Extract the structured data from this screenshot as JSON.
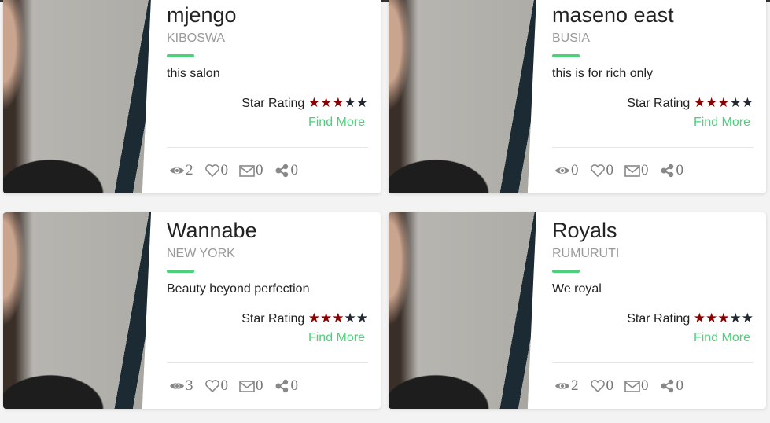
{
  "rating_label": "Star Rating",
  "find_more": "Find More",
  "colors": {
    "accent": "#4cd17a",
    "star_on": "#8b0000",
    "star_off": "#222831"
  },
  "cards": [
    {
      "title": "mjengo",
      "location": "KIBOSWA",
      "description": "this salon",
      "rating": 3,
      "views": "2",
      "likes": "0",
      "messages": "0",
      "shares": "0"
    },
    {
      "title": "maseno east",
      "location": "BUSIA",
      "description": "this is for rich only",
      "rating": 3,
      "views": "0",
      "likes": "0",
      "messages": "0",
      "shares": "0"
    },
    {
      "title": "Wannabe",
      "location": "NEW YORK",
      "description": "Beauty beyond perfection",
      "rating": 3,
      "views": "3",
      "likes": "0",
      "messages": "0",
      "shares": "0"
    },
    {
      "title": "Royals",
      "location": "RUMURUTI",
      "description": "We royal",
      "rating": 3,
      "views": "2",
      "likes": "0",
      "messages": "0",
      "shares": "0"
    }
  ]
}
